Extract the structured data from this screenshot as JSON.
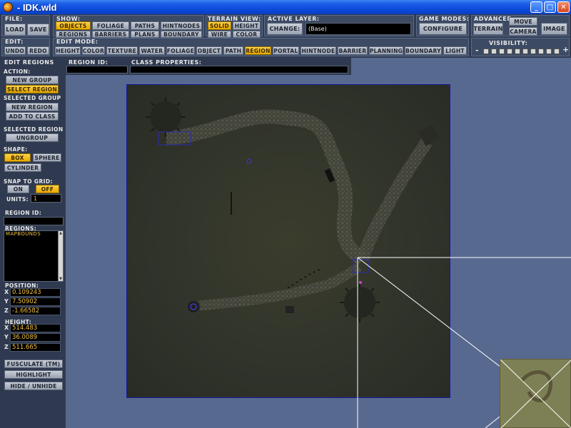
{
  "window": {
    "title": "- IDK.wld",
    "min_glyph": "_",
    "max_glyph": "□",
    "close_glyph": "✕"
  },
  "toolbar": {
    "file": {
      "label": "File:",
      "load": "Load",
      "save": "Save"
    },
    "show": {
      "label": "Show:",
      "items": [
        "Objects",
        "Foliage",
        "Paths",
        "HintNodes",
        "Regions",
        "Barriers",
        "Plans",
        "Boundary"
      ],
      "active": "Objects"
    },
    "terrain_view": {
      "label": "Terrain View:",
      "items": [
        "Solid",
        "Height",
        "Wire",
        "Color"
      ],
      "active": "Solid"
    },
    "active_layer": {
      "label": "Active Layer:",
      "change": "Change:",
      "value": "(Base)"
    },
    "game_modes": {
      "label": "Game Modes:",
      "configure": "Configure"
    },
    "advanced": {
      "label": "Advanced",
      "terrain": "Terrain",
      "move": "Move",
      "camera": "Camera",
      "image": "Image"
    },
    "edit": {
      "label": "Edit:",
      "undo": "Undo",
      "redo": "Redo"
    },
    "edit_mode": {
      "label": "Edit Mode:",
      "items": [
        "Height",
        "Color",
        "Texture",
        "Water",
        "Foliage",
        "Object",
        "Path",
        "Region",
        "Portal",
        "HintNode",
        "Barrier",
        "Planning",
        "Boundary",
        "Light"
      ],
      "active": "Region"
    },
    "visibility": {
      "label": "Visibility:",
      "minus": "-",
      "plus": "+",
      "box_count": 10
    }
  },
  "edit_regions": {
    "title": "Edit Regions",
    "region_id_label": "Region ID:",
    "class_props_label": "Class Properties:"
  },
  "left_panel": {
    "action_label": "Action:",
    "new_group": "New Group",
    "select_region": "Select Region",
    "selected_group_label": "Selected Group",
    "new_region": "New Region",
    "add_to_class": "Add To Class",
    "selected_region_label": "Selected Region",
    "ungroup": "Ungroup",
    "shape_label": "Shape:",
    "box": "Box",
    "sphere": "Sphere",
    "cylinder": "Cylinder",
    "shape_active": "Box",
    "snap_label": "Snap To Grid:",
    "on": "On",
    "off": "Off",
    "snap_active": "Off",
    "units_label": "Units:",
    "units_value": "1",
    "region_id_label": "Region ID:",
    "regions_label": "Regions:",
    "regions": [
      "MapBounds"
    ],
    "position_label": "Position:",
    "pos_x": "0.109243",
    "pos_y": "7.50902",
    "pos_z": "-1.66582",
    "height_label": "Height:",
    "h_x": "514.483",
    "h_y": "36.0089",
    "h_z": "511.665",
    "x": "X",
    "y": "Y",
    "z": "Z",
    "fusculate": "Fusculate (TM)",
    "highlight": "Highlight",
    "hide_unhide": "Hide / Unhide"
  },
  "colors": {
    "accent_active": "#f0c040",
    "panel_bg": "#2f3a50",
    "viewport_bg": "#58698f",
    "terrain": "#30332a",
    "minimap": "#7d8054"
  }
}
